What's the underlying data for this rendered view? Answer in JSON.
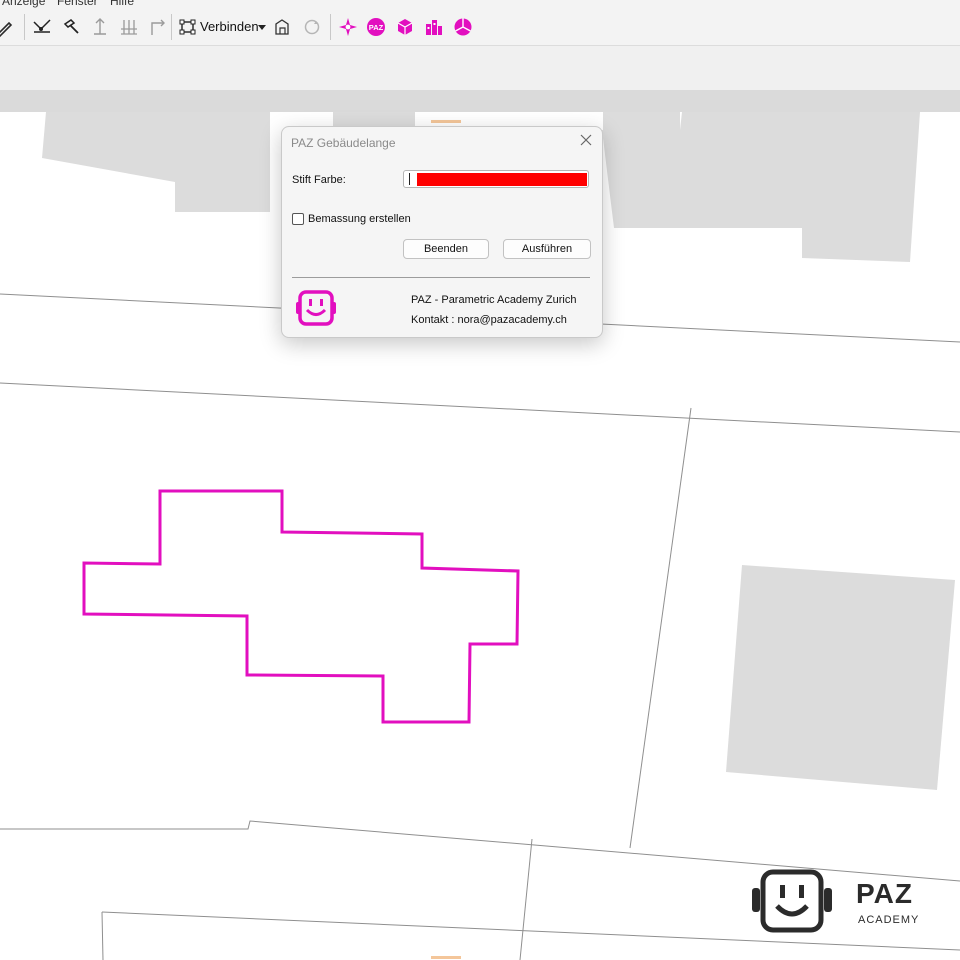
{
  "menu": {
    "items": [
      "Anzeige",
      "Fenster",
      "Hilfe"
    ]
  },
  "toolbar": {
    "connect_label": "Verbinden",
    "icons": [
      "pencil-icon",
      "trim-icon",
      "hammer-icon",
      "extrude-icon",
      "array-icon",
      "corner-icon",
      "connect-icon",
      "building-icon",
      "refresh-icon",
      "paz-cross-icon",
      "paz-logo-icon",
      "paz-cube-icon",
      "paz-buildings-icon",
      "paz-pie-icon"
    ],
    "accent": "#e20fbf"
  },
  "dialog": {
    "title": "PAZ Gebäudelange",
    "pen_color_label": "Stift Farbe:",
    "pen_color_value": "#ff0000",
    "dimension_checkbox_label": "Bemassung erstellen",
    "dimension_checked": false,
    "quit_label": "Beenden",
    "run_label": "Ausführen",
    "org_name": "PAZ - Parametric Academy Zurich",
    "contact": "Kontakt : nora@pazacademy.ch"
  },
  "canvas": {
    "building_outline_color": "#e20fbf",
    "building_fill": "#dcdcdc",
    "parcel_line_color": "#8f8f8f"
  },
  "watermark": {
    "brand": "PAZ",
    "subtitle": "ACADEMY"
  }
}
